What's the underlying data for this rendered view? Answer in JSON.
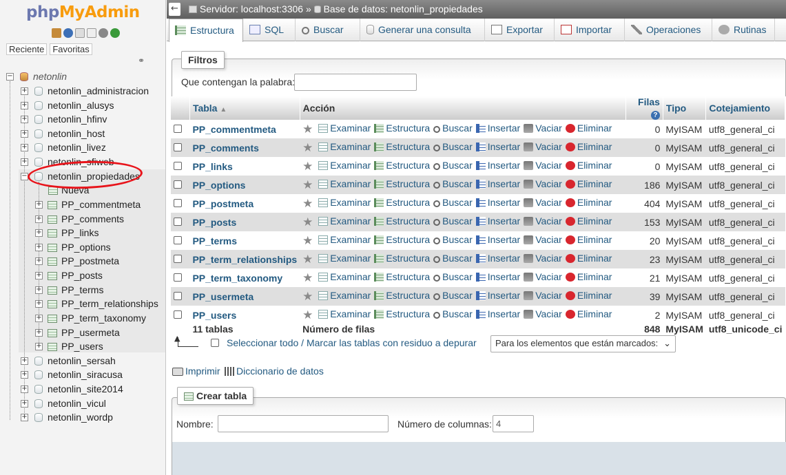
{
  "logo": {
    "part1": "php",
    "part2": "MyAdmin"
  },
  "nav": {
    "tabs": [
      "Reciente",
      "Favoritas"
    ],
    "root": "netonlin",
    "databases_before": [
      "netonlin_administracion",
      "netonlin_alusys",
      "netonlin_hfinv",
      "netonlin_host",
      "netonlin_livez",
      "netonlin_sfiweb"
    ],
    "current_db": "netonlin_propiedades",
    "new_label": "Nueva",
    "tables": [
      "PP_commentmeta",
      "PP_comments",
      "PP_links",
      "PP_options",
      "PP_postmeta",
      "PP_posts",
      "PP_terms",
      "PP_term_relationships",
      "PP_term_taxonomy",
      "PP_usermeta",
      "PP_users"
    ],
    "databases_after": [
      "netonlin_sersah",
      "netonlin_siracusa",
      "netonlin_site2014",
      "netonlin_vicul",
      "netonlin_wordp"
    ]
  },
  "breadcrumb": {
    "server": "Servidor: localhost:3306",
    "sep": "»",
    "database": "Base de datos: netonlin_propiedades"
  },
  "tabs": [
    "Estructura",
    "SQL",
    "Buscar",
    "Generar una consulta",
    "Exportar",
    "Importar",
    "Operaciones",
    "Rutinas"
  ],
  "filters": {
    "legend": "Filtros",
    "label": "Que contengan la palabra:",
    "value": ""
  },
  "table": {
    "headers": {
      "tabla": "Tabla",
      "accion": "Acción",
      "filas": "Filas",
      "tipo": "Tipo",
      "cotejamiento": "Cotejamiento"
    },
    "actions": [
      "Examinar",
      "Estructura",
      "Buscar",
      "Insertar",
      "Vaciar",
      "Eliminar"
    ],
    "rows": [
      {
        "name": "PP_commentmeta",
        "rows": "0",
        "type": "MyISAM",
        "collation": "utf8_general_ci"
      },
      {
        "name": "PP_comments",
        "rows": "0",
        "type": "MyISAM",
        "collation": "utf8_general_ci"
      },
      {
        "name": "PP_links",
        "rows": "0",
        "type": "MyISAM",
        "collation": "utf8_general_ci"
      },
      {
        "name": "PP_options",
        "rows": "186",
        "type": "MyISAM",
        "collation": "utf8_general_ci"
      },
      {
        "name": "PP_postmeta",
        "rows": "404",
        "type": "MyISAM",
        "collation": "utf8_general_ci"
      },
      {
        "name": "PP_posts",
        "rows": "153",
        "type": "MyISAM",
        "collation": "utf8_general_ci"
      },
      {
        "name": "PP_terms",
        "rows": "20",
        "type": "MyISAM",
        "collation": "utf8_general_ci"
      },
      {
        "name": "PP_term_relationships",
        "rows": "23",
        "type": "MyISAM",
        "collation": "utf8_general_ci"
      },
      {
        "name": "PP_term_taxonomy",
        "rows": "21",
        "type": "MyISAM",
        "collation": "utf8_general_ci"
      },
      {
        "name": "PP_usermeta",
        "rows": "39",
        "type": "MyISAM",
        "collation": "utf8_general_ci"
      },
      {
        "name": "PP_users",
        "rows": "2",
        "type": "MyISAM",
        "collation": "utf8_general_ci"
      }
    ],
    "footer": {
      "count": "11 tablas",
      "label": "Número de filas",
      "rows": "848",
      "type": "MyISAM",
      "collation": "utf8_unicode_ci"
    }
  },
  "bulk": {
    "select_all": "Seleccionar todo / Marcar las tablas con residuo a depurar",
    "with_selected": "Para los elementos que están marcados:"
  },
  "links": {
    "print": "Imprimir",
    "dictionary": "Diccionario de datos"
  },
  "create": {
    "legend": "Crear tabla",
    "name_label": "Nombre:",
    "name_value": "",
    "cols_label": "Número de columnas:",
    "cols_value": "4"
  }
}
